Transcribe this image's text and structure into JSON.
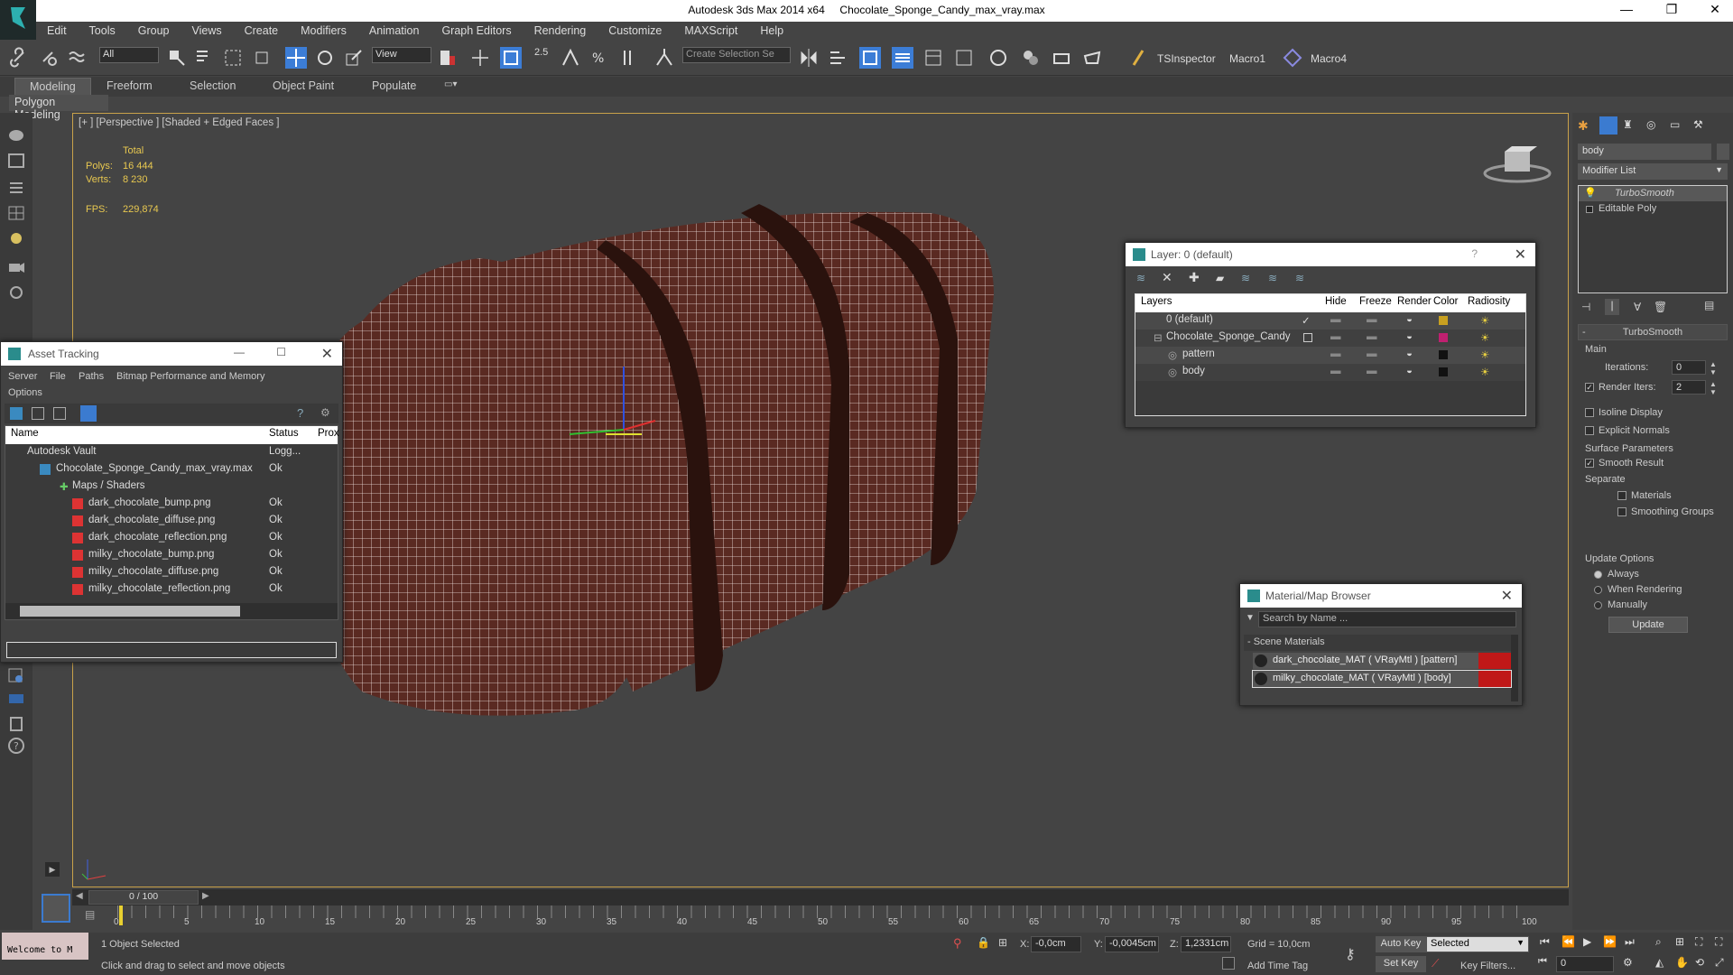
{
  "window": {
    "app_title": "Autodesk 3ds Max  2014 x64",
    "file_title": "Chocolate_Sponge_Candy_max_vray.max"
  },
  "menu": [
    "Edit",
    "Tools",
    "Group",
    "Views",
    "Create",
    "Modifiers",
    "Animation",
    "Graph Editors",
    "Rendering",
    "Customize",
    "MAXScript",
    "Help"
  ],
  "toolbar": {
    "filter_select": "All",
    "ref_coord_select": "View",
    "snap_value": "2.5",
    "selection_set_placeholder": "Create Selection Se",
    "plugin1": "TSInspector",
    "plugin2": "Macro1",
    "plugin3": "Macro4"
  },
  "ribbon": {
    "tabs": [
      "Modeling",
      "Freeform",
      "Selection",
      "Object Paint",
      "Populate"
    ],
    "subtab": "Polygon Modeling"
  },
  "viewport": {
    "label": "[+ ] [Perspective ] [Shaded + Edged Faces ]",
    "stats_header": "Total",
    "polys_label": "Polys:",
    "polys_value": "16 444",
    "verts_label": "Verts:",
    "verts_value": "8 230",
    "fps_label": "FPS:",
    "fps_value": "229,874"
  },
  "asset_tracking": {
    "title": "Asset Tracking",
    "menu": [
      "Server",
      "File",
      "Paths",
      "Bitmap Performance and Memory",
      "Options"
    ],
    "columns": [
      "Name",
      "Status",
      "Prox"
    ],
    "rows": [
      {
        "name": "Autodesk Vault",
        "status": "Logg..."
      },
      {
        "name": "Chocolate_Sponge_Candy_max_vray.max",
        "status": "Ok"
      },
      {
        "name": "Maps / Shaders",
        "status": ""
      },
      {
        "name": "dark_chocolate_bump.png",
        "status": "Ok"
      },
      {
        "name": "dark_chocolate_diffuse.png",
        "status": "Ok"
      },
      {
        "name": "dark_chocolate_reflection.png",
        "status": "Ok"
      },
      {
        "name": "milky_chocolate_bump.png",
        "status": "Ok"
      },
      {
        "name": "milky_chocolate_diffuse.png",
        "status": "Ok"
      },
      {
        "name": "milky_chocolate_reflection.png",
        "status": "Ok"
      }
    ]
  },
  "layer_window": {
    "title": "Layer: 0 (default)",
    "help": "?",
    "columns": [
      "Layers",
      "Hide",
      "Freeze",
      "Render",
      "Color",
      "Radiosity"
    ],
    "rows": [
      {
        "name": "0 (default)",
        "color": "#c8a020"
      },
      {
        "name": "Chocolate_Sponge_Candy",
        "color": "#c02070"
      },
      {
        "name": "pattern",
        "color": "#111111"
      },
      {
        "name": "body",
        "color": "#111111"
      }
    ]
  },
  "material_browser": {
    "title": "Material/Map Browser",
    "search_placeholder": "Search by Name ...",
    "group": "- Scene Materials",
    "items": [
      "dark_chocolate_MAT  ( VRayMtl )  [pattern]",
      "milky_chocolate_MAT  ( VRayMtl )  [body]"
    ]
  },
  "command_panel": {
    "object_name": "body",
    "modifier_list": "Modifier List",
    "stack": [
      "TurboSmooth",
      "Editable Poly"
    ],
    "rollout_title": "TurboSmooth",
    "main_label": "Main",
    "iterations_label": "Iterations:",
    "iterations_value": "0",
    "render_iters_label": "Render Iters:",
    "render_iters_value": "2",
    "isoline": "Isoline Display",
    "explicit": "Explicit Normals",
    "surface_params": "Surface Parameters",
    "smooth_result": "Smooth Result",
    "separate": "Separate",
    "materials": "Materials",
    "smoothing_groups": "Smoothing Groups",
    "update_options": "Update Options",
    "always": "Always",
    "when_rendering": "When Rendering",
    "manually": "Manually",
    "update_button": "Update"
  },
  "timeline": {
    "frame_counter": "0 / 100",
    "ticks": [
      "0",
      "5",
      "10",
      "15",
      "20",
      "25",
      "30",
      "35",
      "40",
      "45",
      "50",
      "55",
      "60",
      "65",
      "70",
      "75",
      "80",
      "85",
      "90",
      "95",
      "100"
    ]
  },
  "status": {
    "welcome": "Welcome to M",
    "selected": "1 Object Selected",
    "prompt": "Click and drag to select and move objects",
    "x_label": "X:",
    "x_value": "-0,0cm",
    "y_label": "Y:",
    "y_value": "-0,0045cm",
    "z_label": "Z:",
    "z_value": "1,2331cm",
    "grid": "Grid = 10,0cm",
    "add_time_tag": "Add Time Tag",
    "auto_key": "Auto Key",
    "set_key": "Set Key",
    "key_mode": "Selected",
    "key_filters": "Key Filters...",
    "frame_field": "0"
  },
  "colors": {
    "viewport_border": "#c9a24a",
    "stats_text": "#e8c850",
    "chocolate": "#5a2a22",
    "material_swatch": "#c01818"
  }
}
